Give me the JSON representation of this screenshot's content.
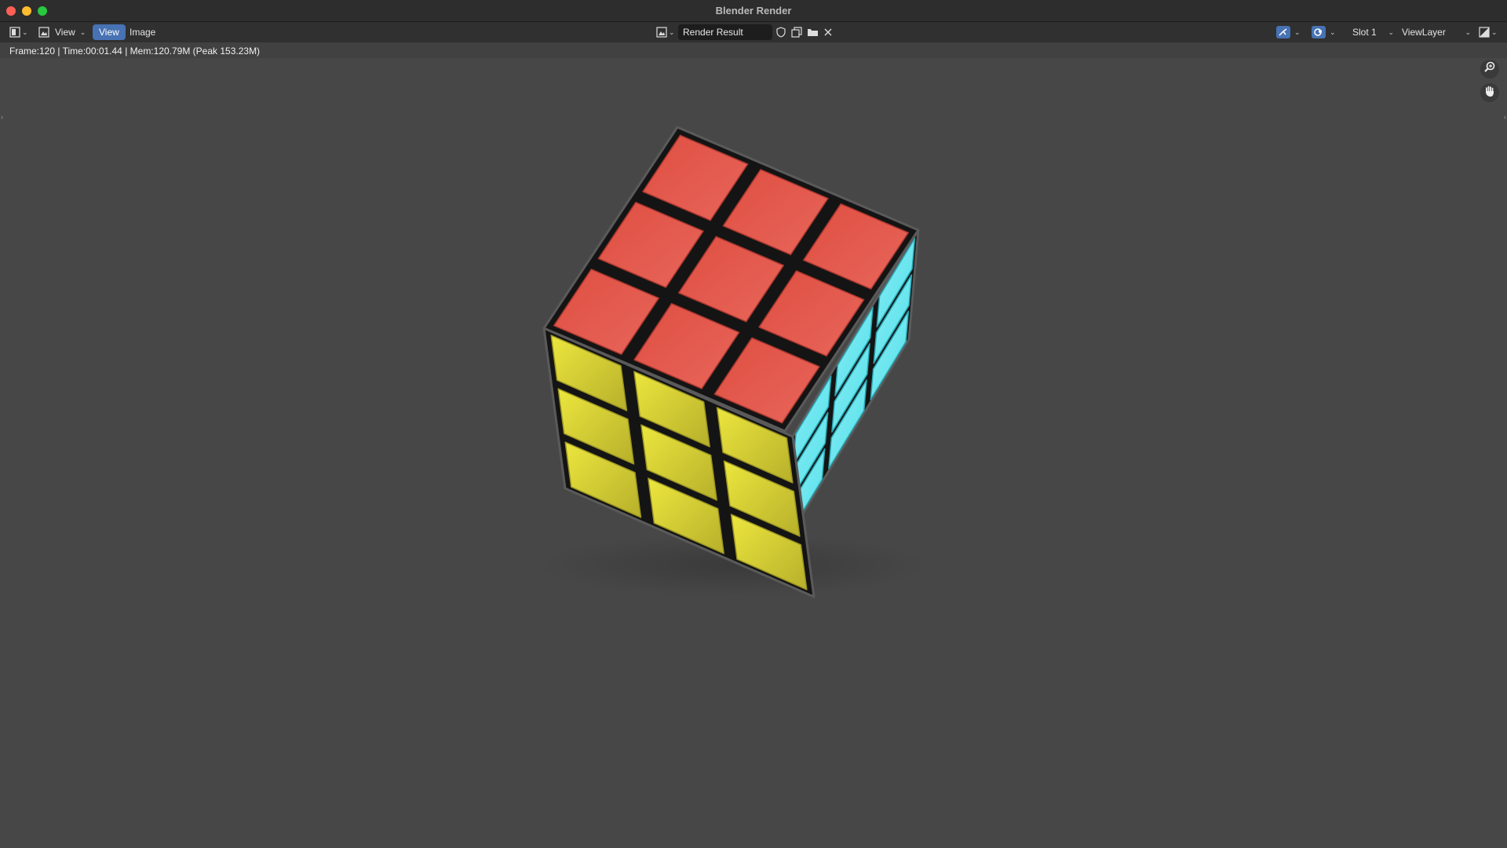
{
  "window": {
    "title": "Blender Render"
  },
  "header": {
    "editor_menu_view": "View",
    "view_tab": "View",
    "image_tab": "Image",
    "image_name": "Render Result",
    "slot": "Slot 1",
    "view_layer": "ViewLayer"
  },
  "info": {
    "text": "Frame:120 | Time:00:01.44 | Mem:120.79M (Peak 153.23M)"
  },
  "icons": {
    "editor_type": "image-editor-icon",
    "mode": "view-mode-icon",
    "image_browse": "image-browse-icon",
    "fake_user": "shield-icon",
    "new_image": "new-image-icon",
    "open_image": "folder-icon",
    "unlink": "close-icon",
    "gizmo": "gizmo-icon",
    "overlay": "overlay-icon",
    "display_channels": "display-channels-icon",
    "zoom": "zoom-icon",
    "pan": "hand-icon"
  },
  "colors": {
    "top_face": "#e8655a",
    "front_face": "#e0d93b",
    "side_face": "#4de0ec",
    "accent": "#4772b3",
    "background": "#474747"
  }
}
